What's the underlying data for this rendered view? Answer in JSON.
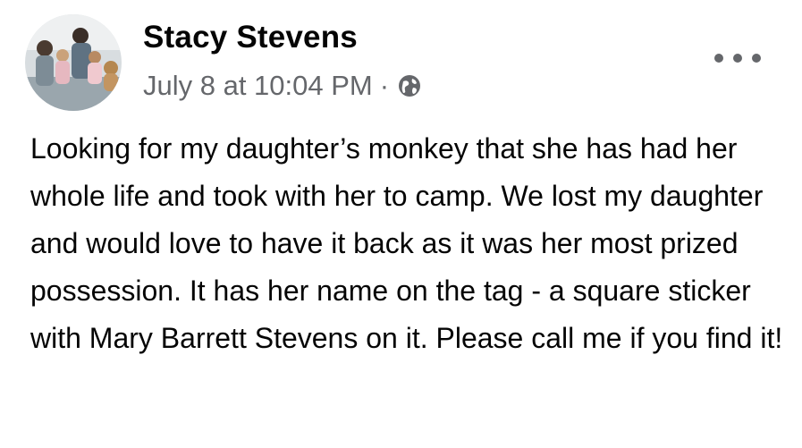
{
  "post": {
    "author_name": "Stacy Stevens",
    "timestamp": "July 8 at 10:04 PM",
    "separator": "·",
    "audience_icon": "globe-icon",
    "more_icon": "more-options-icon",
    "message": "Looking for my daughter’s monkey that she has had her whole life and took with her to camp. We lost my daughter and would love to have it back as it was her most prized possession. It has her name on the tag - a square sticker with Mary Barrett Stevens on it. Please call me if you find it!"
  },
  "colors": {
    "text_primary": "#050505",
    "text_secondary": "#65676b",
    "background": "#ffffff"
  }
}
